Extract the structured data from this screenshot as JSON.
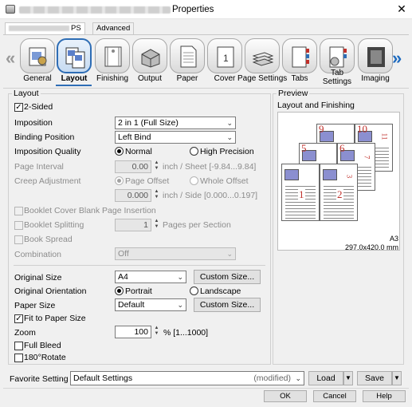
{
  "window": {
    "title": "Properties",
    "close_glyph": "✕"
  },
  "top_tabs": {
    "tab1_suffix": "PS",
    "tab2": "Advanced"
  },
  "ribbon": {
    "tabs": [
      {
        "label": "General"
      },
      {
        "label": "Layout"
      },
      {
        "label": "Finishing"
      },
      {
        "label": "Output"
      },
      {
        "label": "Paper"
      },
      {
        "label": "Cover"
      },
      {
        "label": "Page Settings"
      },
      {
        "label": "Tabs"
      },
      {
        "label": "Tab Settings"
      },
      {
        "label": "Imaging"
      }
    ],
    "selected": "Layout",
    "cover_digit": "1"
  },
  "layout": {
    "group": "Layout",
    "two_sided": "2-Sided",
    "two_sided_checked": true,
    "imposition_label": "Imposition",
    "imposition_value": "2 in 1 (Full Size)",
    "binding_label": "Binding Position",
    "binding_value": "Left Bind",
    "quality_label": "Imposition Quality",
    "quality_normal": "Normal",
    "quality_high": "High Precision",
    "interval_label": "Page Interval",
    "interval_value": "0.00",
    "interval_unit": "inch / Sheet [-9.84...9.84]",
    "creep_label": "Creep Adjustment",
    "creep_page_offset": "Page Offset",
    "creep_whole_offset": "Whole Offset",
    "creep_value": "0.000",
    "creep_unit": "inch / Side [0.000...0.197]",
    "booklet_cover": "Booklet Cover Blank Page Insertion",
    "booklet_split": "Booklet Splitting",
    "split_value": "1",
    "split_unit": "Pages per Section",
    "book_spread": "Book Spread",
    "combination_label": "Combination",
    "combination_value": "Off",
    "orig_size_label": "Original Size",
    "orig_size_value": "A4",
    "custom_size_btn": "Custom Size...",
    "orientation_label": "Original Orientation",
    "portrait": "Portrait",
    "landscape": "Landscape",
    "paper_size_label": "Paper Size",
    "paper_size_value": "Default",
    "custom_size_btn2": "Custom Size...",
    "fit_to_paper": "Fit to Paper Size",
    "fit_checked": true,
    "zoom_label": "Zoom",
    "zoom_value": "100",
    "zoom_unit": "% [1...1000]",
    "full_bleed": "Full Bleed",
    "rotate": "180°Rotate"
  },
  "preview": {
    "group": "Preview",
    "heading": "Layout and Finishing",
    "page_numbers": [
      "9",
      "10",
      "11",
      "5",
      "6",
      "7",
      "3",
      "1",
      "2"
    ],
    "paper": "A3",
    "dimensions": "297.0x420.0 mm"
  },
  "favorite": {
    "label": "Favorite Setting",
    "value": "Default Settings",
    "modified": "(modified)",
    "load": "Load",
    "save": "Save"
  },
  "footer": {
    "ok": "OK",
    "cancel": "Cancel",
    "help": "Help"
  }
}
